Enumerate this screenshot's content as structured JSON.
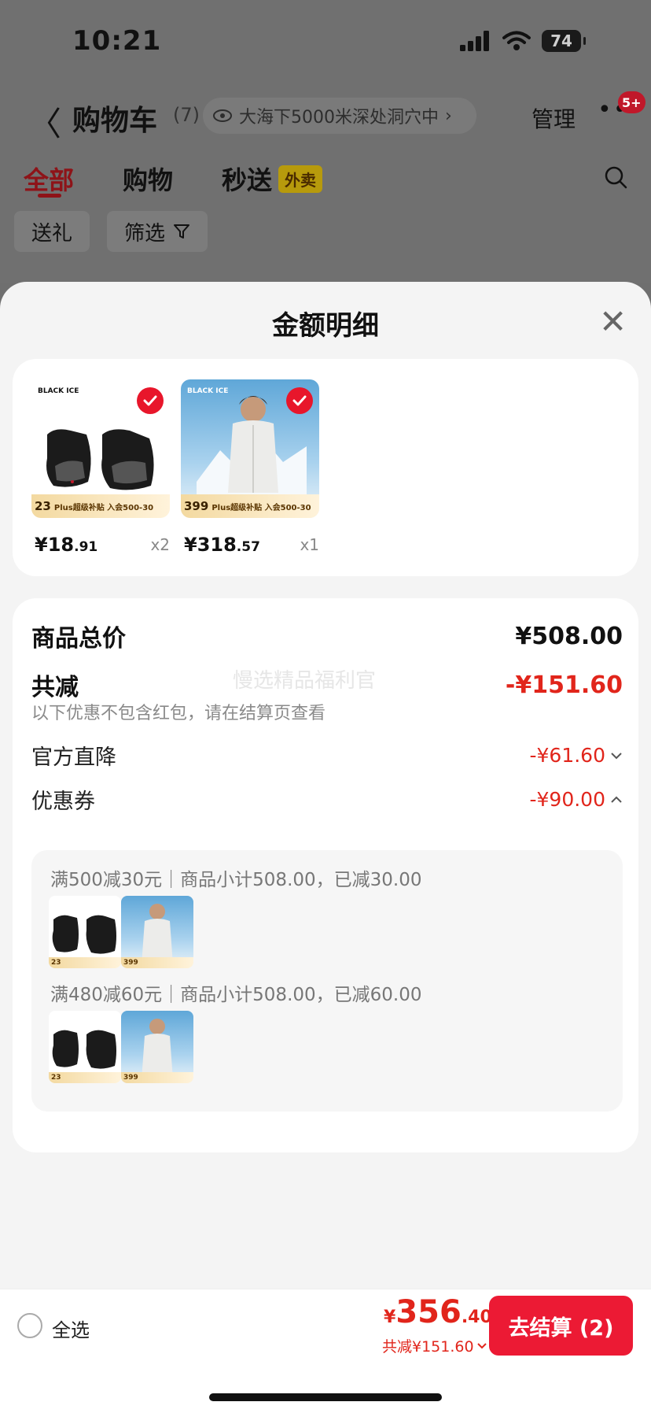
{
  "status_bar": {
    "time": "10:21",
    "battery": "74"
  },
  "header": {
    "back_glyph": "〈",
    "title": "购物车",
    "count": "(7)",
    "address": "大海下5000米深处洞穴中",
    "address_chevron": "›",
    "manage": "管理",
    "more": "•••",
    "badge": "5+"
  },
  "tabs": [
    {
      "label": "全部"
    },
    {
      "label": "购物"
    },
    {
      "label": "秒送"
    }
  ],
  "waimai_tag": "外卖",
  "chips": {
    "gift": "送礼",
    "filter": "筛选"
  },
  "sheet": {
    "title": "金额明细",
    "close": "✕",
    "products": [
      {
        "price_int": "¥18",
        "price_dec": ".91",
        "qty": "x2",
        "strip_price": "23",
        "strip_text": "Plus超级补贴 入会500-30",
        "image": "socks"
      },
      {
        "price_int": "¥318",
        "price_dec": ".57",
        "qty": "x1",
        "strip_price": "399",
        "strip_text": "Plus超级补贴 入会500-30",
        "image": "coat"
      }
    ],
    "brand": "BLACK ICE",
    "summary": {
      "total_label": "商品总价",
      "total_value": "¥508.00",
      "discount_label": "共减",
      "discount_value": "-¥151.60",
      "note": "以下优惠不包含红包，请在结算页查看",
      "watermark": "慢选精品福利官",
      "official_label": "官方直降",
      "official_value": "-¥61.60",
      "coupon_label": "优惠券",
      "coupon_value": "-¥90.00"
    },
    "coupons": [
      {
        "text": "满500减30元｜商品小计508.00，已减30.00"
      },
      {
        "text": "满480减60元｜商品小计508.00，已减60.00"
      }
    ]
  },
  "bottom_bar": {
    "select_all": "全选",
    "currency": "¥",
    "total_int": "356",
    "total_dec": ".40",
    "discount": "共减¥151.60",
    "checkout": "去结算 (2)"
  },
  "colors": {
    "accent_red": "#e1251b",
    "button_red": "#ec1a34",
    "check_red": "#e8162b"
  }
}
